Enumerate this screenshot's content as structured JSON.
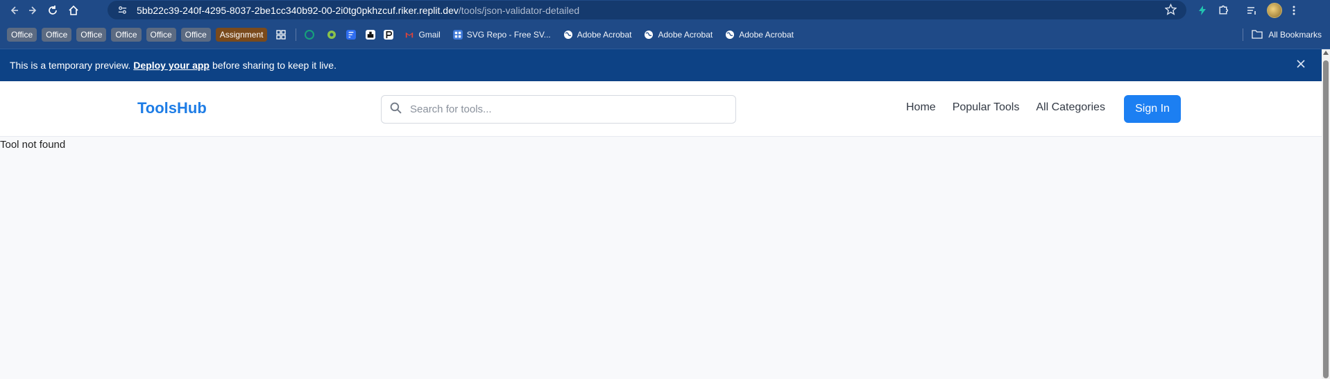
{
  "browser": {
    "url_host": "5bb22c39-240f-4295-8037-2be1cc340b92-00-2i0tg0pkhzcuf.riker.replit.dev",
    "url_path": "/tools/json-validator-detailed"
  },
  "bookmarks": {
    "chips": [
      "Office",
      "Office",
      "Office",
      "Office",
      "Office",
      "Office",
      "Assignment"
    ],
    "items": [
      {
        "label": "Gmail",
        "icon": "gmail-icon"
      },
      {
        "label": "SVG Repo - Free SV...",
        "icon": "svgrepo-icon"
      },
      {
        "label": "Adobe Acrobat",
        "icon": "globe-icon"
      },
      {
        "label": "Adobe Acrobat",
        "icon": "globe-icon"
      },
      {
        "label": "Adobe Acrobat",
        "icon": "globe-icon"
      }
    ],
    "all_label": "All Bookmarks"
  },
  "banner": {
    "text_before": "This is a temporary preview.",
    "link": "Deploy your app",
    "text_after": "before sharing to keep it live."
  },
  "header": {
    "logo": "ToolsHub",
    "search_placeholder": "Search for tools...",
    "nav": [
      "Home",
      "Popular Tools",
      "All Categories"
    ],
    "signin": "Sign In"
  },
  "content": {
    "message": "Tool not found"
  },
  "colors": {
    "brand": "#1e7de6",
    "banner": "#0d4285",
    "browser_chrome": "#1f4a87"
  }
}
